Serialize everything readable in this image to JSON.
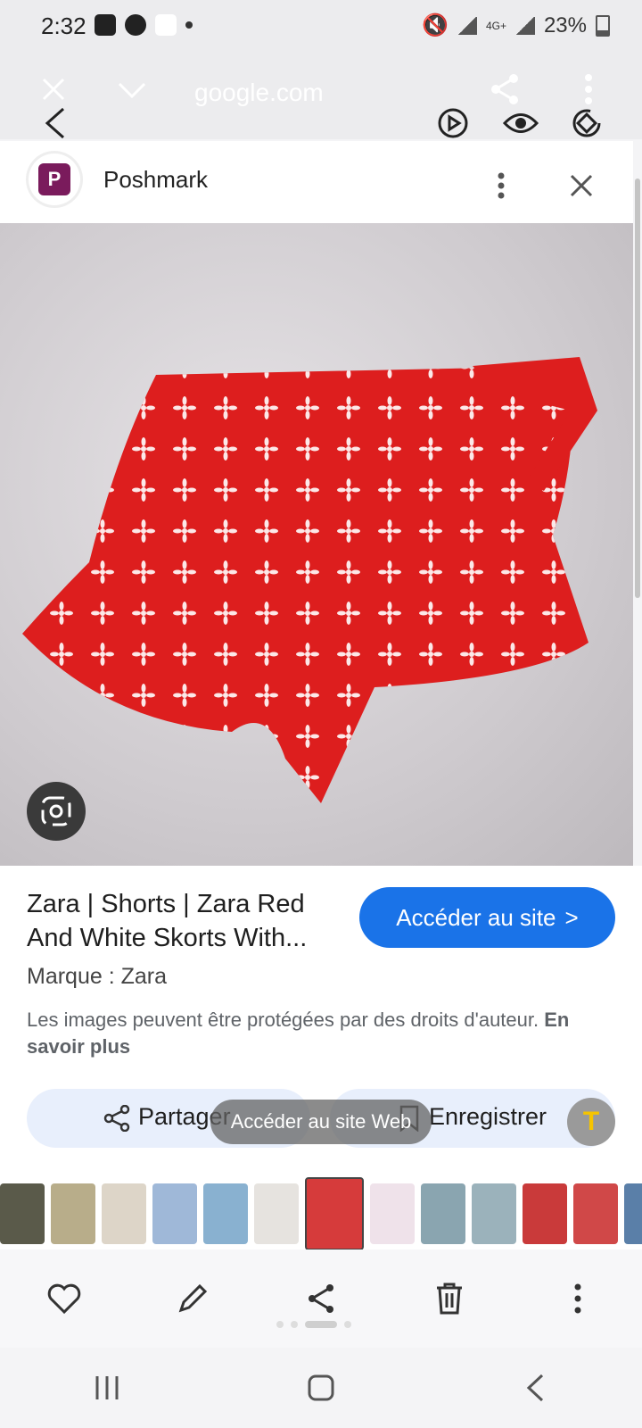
{
  "status_bar": {
    "time": "2:32",
    "network": "4G+",
    "battery": "23%"
  },
  "browser": {
    "url": "google.com",
    "icons": [
      "close-icon",
      "chevron-down-icon",
      "share-icon",
      "more-vert-icon",
      "back-icon",
      "video-icon",
      "eye-icon",
      "rotate-icon"
    ]
  },
  "source": {
    "name": "Poshmark",
    "logo_letter": "P"
  },
  "result": {
    "title": "Zara | Shorts | Zara Red And White Skorts With...",
    "brand_label": "Marque : Zara",
    "copyright_text": "Les images peuvent être protégées par des droits d'auteur.",
    "learn_more": "En savoir plus",
    "visit_button": "Accéder au site",
    "visit_chevron": ">"
  },
  "actions": {
    "share_label": "Partager",
    "save_label": "Enregistrer"
  },
  "toast": {
    "text": "Accéder au site Web"
  },
  "text_badge": {
    "label": "T"
  },
  "thumbnails": [
    {
      "color": "#5a5a4a"
    },
    {
      "color": "#b8ad8a"
    },
    {
      "color": "#ddd5c8"
    },
    {
      "color": "#9fb8d8"
    },
    {
      "color": "#89b1d0"
    },
    {
      "color": "#e6e3df"
    },
    {
      "color": "#d63b3b"
    },
    {
      "color": "#efe2ea"
    },
    {
      "color": "#8aa5b0"
    },
    {
      "color": "#9bb2bb"
    },
    {
      "color": "#c93a3a"
    },
    {
      "color": "#d04848"
    },
    {
      "color": "#5a7fa8"
    }
  ],
  "selected_thumbnail_index": 6,
  "colors": {
    "accent": "#1a73e8",
    "shorts_red": "#dd1e1e",
    "poshmark": "#7a1b5c"
  }
}
